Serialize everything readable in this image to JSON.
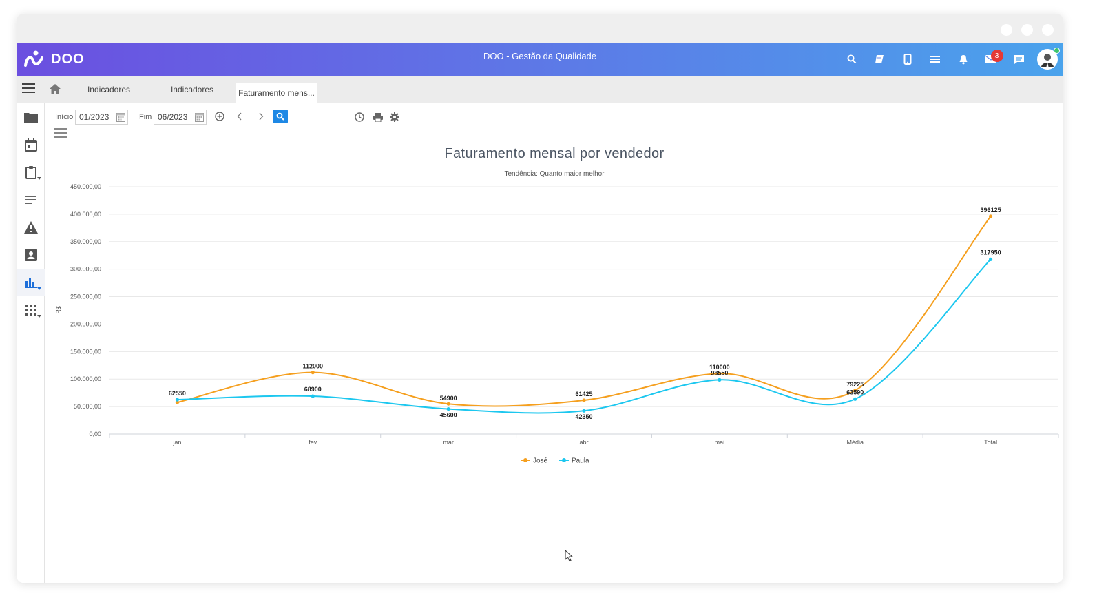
{
  "header": {
    "logo_text": "DOO",
    "title": "DOO - Gestão da Qualidade",
    "icons": [
      "search-icon",
      "book-icon",
      "mobile-icon",
      "list-icon",
      "bell-icon",
      "mail-icon",
      "chat-icon"
    ],
    "mail_badge": "3"
  },
  "tabs": [
    {
      "label": "Indicadores"
    },
    {
      "label": "Indicadores"
    },
    {
      "label": "Faturamento mens..."
    }
  ],
  "sidebar": {
    "icons": [
      "folder-icon",
      "calendar-icon",
      "clipboard-icon",
      "text-lines-icon",
      "warning-icon",
      "contact-card-icon",
      "bar-chart-icon",
      "apps-grid-icon"
    ]
  },
  "toolbar": {
    "start_label": "Início",
    "start_value": "01/2023",
    "end_label": "Fim",
    "end_value": "06/2023"
  },
  "chart_data": {
    "type": "line",
    "title": "Faturamento mensal por vendedor",
    "subtitle": "Tendência: Quanto maior melhor",
    "ylabel": "R$",
    "xlabel": "",
    "categories": [
      "jan",
      "fev",
      "mar",
      "abr",
      "mai",
      "Média",
      "Total"
    ],
    "ylim": [
      0,
      450000
    ],
    "yticks": [
      "0,00",
      "50.000,00",
      "100.000,00",
      "150.000,00",
      "200.000,00",
      "250.000,00",
      "300.000,00",
      "350.000,00",
      "400.000,00",
      "450.000,00"
    ],
    "series": [
      {
        "name": "José",
        "color": "#f59f1e",
        "values": [
          57550,
          112000,
          54900,
          61425,
          110000,
          79225,
          396125
        ],
        "labels": [
          "",
          "112000",
          "54900",
          "61425",
          "110000",
          "79225",
          "396125"
        ]
      },
      {
        "name": "Paula",
        "color": "#1cc7ef",
        "values": [
          62550,
          68900,
          45600,
          42350,
          98550,
          63590,
          317950
        ],
        "labels": [
          "62550",
          "68900",
          "45600",
          "42350",
          "98550",
          "63590",
          "317950"
        ]
      }
    ],
    "grid": true,
    "legend": "bottom-center"
  }
}
